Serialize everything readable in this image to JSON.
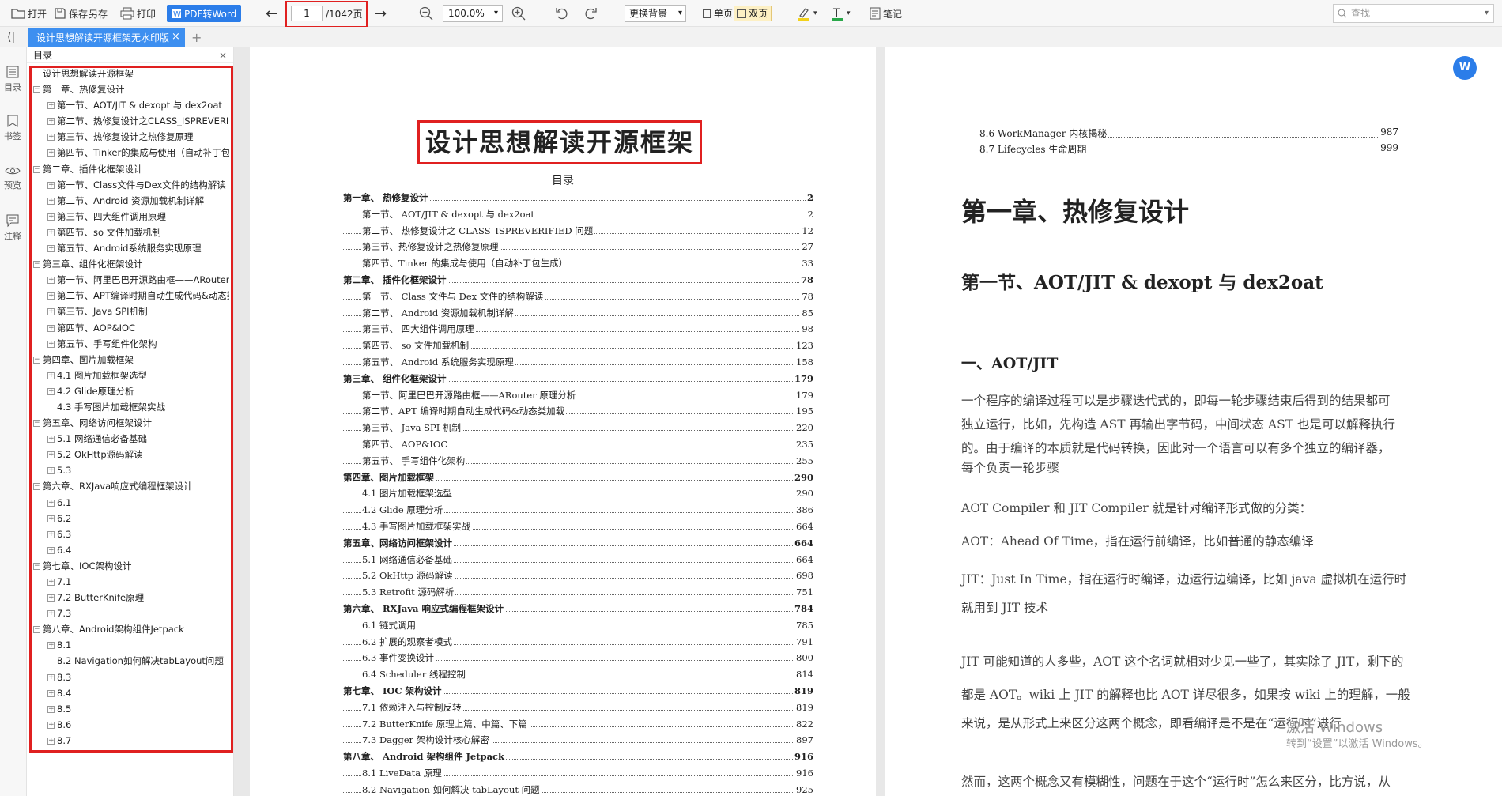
{
  "toolbar": {
    "open": "打开",
    "save": "保存",
    "save_as": "另存",
    "print": "打印",
    "pdf_to_word": "PDF转Word",
    "page_current": "1",
    "page_total": "/1042页",
    "zoom": "100.0%",
    "background": "更换背景",
    "single_page": "单页",
    "double_page": "双页",
    "notes": "笔记",
    "search_placeholder": "查找"
  },
  "tab": {
    "title": "设计思想解读开源框架无水印版"
  },
  "rail": {
    "outline": "目录",
    "bookmarks": "书签",
    "preview": "预览",
    "annotations": "注释"
  },
  "outline": {
    "header": "目录",
    "items": [
      {
        "label": "设计思想解读开源框架",
        "level": 0,
        "toggle": ""
      },
      {
        "label": "第一章、热修复设计",
        "level": 0,
        "toggle": "-"
      },
      {
        "label": "第一节、AOT/JIT & dexopt 与 dex2oat",
        "level": 1,
        "toggle": "+"
      },
      {
        "label": "第二节、热修复设计之CLASS_ISPREVERIFIED问题",
        "level": 1,
        "toggle": "+"
      },
      {
        "label": "第三节、热修复设计之热修复原理",
        "level": 1,
        "toggle": "+"
      },
      {
        "label": "第四节、Tinker的集成与使用（自动补丁包生成）",
        "level": 1,
        "toggle": "+"
      },
      {
        "label": "第二章、插件化框架设计",
        "level": 0,
        "toggle": "-"
      },
      {
        "label": "第一节、Class文件与Dex文件的结构解读",
        "level": 1,
        "toggle": "+"
      },
      {
        "label": "第二节、Android 资源加载机制详解",
        "level": 1,
        "toggle": "+"
      },
      {
        "label": "第三节、四大组件调用原理",
        "level": 1,
        "toggle": "+"
      },
      {
        "label": "第四节、so 文件加载机制",
        "level": 1,
        "toggle": "+"
      },
      {
        "label": "第五节、Android系统服务实现原理",
        "level": 1,
        "toggle": "+"
      },
      {
        "label": "第三章、组件化框架设计",
        "level": 0,
        "toggle": "-"
      },
      {
        "label": "第一节、阿里巴巴开源路由框——ARouter原理分析",
        "level": 1,
        "toggle": "+"
      },
      {
        "label": "第二节、APT编译时期自动生成代码&动态类加载",
        "level": 1,
        "toggle": "+"
      },
      {
        "label": "第三节、Java SPI机制",
        "level": 1,
        "toggle": "+"
      },
      {
        "label": "第四节、AOP&IOC",
        "level": 1,
        "toggle": "+"
      },
      {
        "label": "第五节、手写组件化架构",
        "level": 1,
        "toggle": "+"
      },
      {
        "label": "第四章、图片加载框架",
        "level": 0,
        "toggle": "-"
      },
      {
        "label": "4.1 图片加载框架选型",
        "level": 1,
        "toggle": "+"
      },
      {
        "label": "4.2 Glide原理分析",
        "level": 1,
        "toggle": "+"
      },
      {
        "label": "4.3 手写图片加载框架实战",
        "level": 1,
        "toggle": ""
      },
      {
        "label": "第五章、网络访问框架设计",
        "level": 0,
        "toggle": "-"
      },
      {
        "label": "5.1 网络通信必备基础",
        "level": 1,
        "toggle": "+"
      },
      {
        "label": "5.2 OkHttp源码解读",
        "level": 1,
        "toggle": "+"
      },
      {
        "label": "5.3",
        "level": 1,
        "toggle": "+"
      },
      {
        "label": "第六章、RXJava响应式编程框架设计",
        "level": 0,
        "toggle": "-"
      },
      {
        "label": "6.1",
        "level": 1,
        "toggle": "+"
      },
      {
        "label": "6.2",
        "level": 1,
        "toggle": "+"
      },
      {
        "label": "6.3",
        "level": 1,
        "toggle": "+"
      },
      {
        "label": "6.4",
        "level": 1,
        "toggle": "+"
      },
      {
        "label": "第七章、IOC架构设计",
        "level": 0,
        "toggle": "-"
      },
      {
        "label": "7.1",
        "level": 1,
        "toggle": "+"
      },
      {
        "label": "7.2 ButterKnife原理",
        "level": 1,
        "toggle": "+"
      },
      {
        "label": "7.3",
        "level": 1,
        "toggle": "+"
      },
      {
        "label": "第八章、Android架构组件Jetpack",
        "level": 0,
        "toggle": "-"
      },
      {
        "label": "8.1",
        "level": 1,
        "toggle": "+"
      },
      {
        "label": "8.2 Navigation如何解决tabLayout问题",
        "level": 1,
        "toggle": ""
      },
      {
        "label": "8.3",
        "level": 1,
        "toggle": "+"
      },
      {
        "label": "8.4",
        "level": 1,
        "toggle": "+"
      },
      {
        "label": "8.5",
        "level": 1,
        "toggle": "+"
      },
      {
        "label": "8.6",
        "level": 1,
        "toggle": "+"
      },
      {
        "label": "8.7",
        "level": 1,
        "toggle": "+"
      }
    ]
  },
  "page1": {
    "title": "设计思想解读开源框架",
    "toc_label": "目录",
    "toc": [
      {
        "label": "第一章、 热修复设计",
        "page": "2",
        "chapter": true
      },
      {
        "label": "第一节、 AOT/JIT & dexopt 与 dex2oat",
        "page": "2",
        "chapter": false
      },
      {
        "label": "第二节、 热修复设计之 CLASS_ISPREVERIFIED 问题",
        "page": "12",
        "chapter": false
      },
      {
        "label": "第三节、热修复设计之热修复原理",
        "page": "27",
        "chapter": false
      },
      {
        "label": "第四节、Tinker 的集成与使用（自动补丁包生成）",
        "page": "33",
        "chapter": false
      },
      {
        "label": "第二章、 插件化框架设计",
        "page": "78",
        "chapter": true
      },
      {
        "label": "第一节、 Class 文件与 Dex 文件的结构解读",
        "page": "78",
        "chapter": false
      },
      {
        "label": "第二节、 Android 资源加载机制详解",
        "page": "85",
        "chapter": false
      },
      {
        "label": "第三节、 四大组件调用原理",
        "page": "98",
        "chapter": false
      },
      {
        "label": "第四节、 so 文件加载机制",
        "page": "123",
        "chapter": false
      },
      {
        "label": "第五节、 Android 系统服务实现原理",
        "page": "158",
        "chapter": false
      },
      {
        "label": "第三章、 组件化框架设计",
        "page": "179",
        "chapter": true
      },
      {
        "label": "第一节、阿里巴巴开源路由框——ARouter 原理分析",
        "page": "179",
        "chapter": false
      },
      {
        "label": "第二节、APT 编译时期自动生成代码&动态类加载",
        "page": "195",
        "chapter": false
      },
      {
        "label": "第三节、 Java SPI 机制",
        "page": "220",
        "chapter": false
      },
      {
        "label": "第四节、 AOP&IOC",
        "page": "235",
        "chapter": false
      },
      {
        "label": "第五节、 手写组件化架构",
        "page": "255",
        "chapter": false
      },
      {
        "label": "第四章、图片加载框架",
        "page": "290",
        "chapter": true
      },
      {
        "label": "4.1 图片加载框架选型",
        "page": "290",
        "chapter": false
      },
      {
        "label": "4.2 Glide 原理分析",
        "page": "386",
        "chapter": false
      },
      {
        "label": "4.3 手写图片加载框架实战",
        "page": "664",
        "chapter": false
      },
      {
        "label": "第五章、网络访问框架设计",
        "page": "664",
        "chapter": true
      },
      {
        "label": "5.1 网络通信必备基础",
        "page": "664",
        "chapter": false
      },
      {
        "label": "5.2 OkHttp 源码解读",
        "page": "698",
        "chapter": false
      },
      {
        "label": "5.3 Retrofit 源码解析",
        "page": "751",
        "chapter": false
      },
      {
        "label": "第六章、 RXJava 响应式编程框架设计",
        "page": "784",
        "chapter": true
      },
      {
        "label": "6.1 链式调用",
        "page": "785",
        "chapter": false
      },
      {
        "label": "6.2 扩展的观察者模式",
        "page": "791",
        "chapter": false
      },
      {
        "label": "6.3 事件变换设计",
        "page": "800",
        "chapter": false
      },
      {
        "label": "6.4 Scheduler 线程控制",
        "page": "814",
        "chapter": false
      },
      {
        "label": "第七章、 IOC 架构设计",
        "page": "819",
        "chapter": true
      },
      {
        "label": "7.1 依赖注入与控制反转",
        "page": "819",
        "chapter": false
      },
      {
        "label": "7.2 ButterKnife 原理上篇、中篇、下篇",
        "page": "822",
        "chapter": false
      },
      {
        "label": "7.3 Dagger 架构设计核心解密",
        "page": "897",
        "chapter": false
      },
      {
        "label": "第八章、 Android 架构组件 Jetpack",
        "page": "916",
        "chapter": true
      },
      {
        "label": "8.1 LiveData 原理",
        "page": "916",
        "chapter": false
      },
      {
        "label": "8.2 Navigation 如何解决 tabLayout 问题",
        "page": "925",
        "chapter": false
      }
    ]
  },
  "page2": {
    "toc_rest": [
      {
        "label": "8.6 WorkManager 内核揭秘",
        "page": "987"
      },
      {
        "label": "8.7 Lifecycles 生命周期",
        "page": "999"
      }
    ],
    "h1": "第一章、热修复设计",
    "h2": "第一节、AOT/JIT & dexopt 与 dex2oat",
    "h3": "一、AOT/JIT",
    "para1": [
      "一个程序的编译过程可以是步骤迭代式的，即每一轮步骤结束后得到的结果都可",
      "独立运行，比如，先构造 AST 再输出字节码，中间状态 AST 也是可以解释执行",
      "的。由于编译的本质就是代码转换，因此对一个语言可以有多个独立的编译器，",
      "每个负责一轮步骤"
    ],
    "para2": "AOT Compiler 和 JIT Compiler 就是针对编译形式做的分类：",
    "para3": "AOT：Ahead Of Time，指在运行前编译，比如普通的静态编译",
    "para4": [
      "JIT：Just In Time，指在运行时编译，边运行边编译，比如 java 虚拟机在运行时",
      "就用到 JIT 技术"
    ],
    "para5": [
      "JIT 可能知道的人多些，AOT 这个名词就相对少见一些了，其实除了 JIT，剩下的",
      "都是 AOT。wiki 上 JIT 的解释也比 AOT 详尽很多，如果按 wiki 上的理解，一般",
      "来说，是从形式上来区分这两个概念，即看编译是不是在“运行时”进行"
    ],
    "para6": "然而，这两个概念又有模糊性，问题在于这个“运行时”怎么来区分，比方说，从",
    "watermark1": "激活 Windows",
    "watermark2": "转到“设置”以激活 Windows。"
  },
  "colors": {
    "accent": "#2b7de9",
    "highlight_red": "#e02020",
    "tab_blue": "#3d8ff0"
  }
}
